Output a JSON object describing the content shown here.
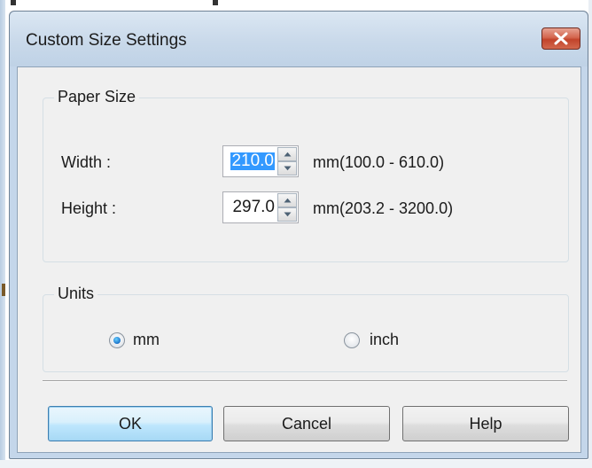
{
  "dialog": {
    "title": "Custom Size Settings",
    "close_icon": "close-icon"
  },
  "paper_size": {
    "legend": "Paper Size",
    "width": {
      "label": "Width :",
      "value": "210.0",
      "range": "mm(100.0 - 610.0)"
    },
    "height": {
      "label": "Height :",
      "value": "297.0",
      "range": "mm(203.2 - 3200.0)"
    }
  },
  "units": {
    "legend": "Units",
    "options": [
      {
        "label": "mm",
        "selected": true
      },
      {
        "label": "inch",
        "selected": false
      }
    ]
  },
  "buttons": {
    "ok": "OK",
    "cancel": "Cancel",
    "help": "Help"
  },
  "colors": {
    "selection": "#3399ff",
    "close_button": "#c2442b",
    "titlebar": "#c9d9ea"
  }
}
